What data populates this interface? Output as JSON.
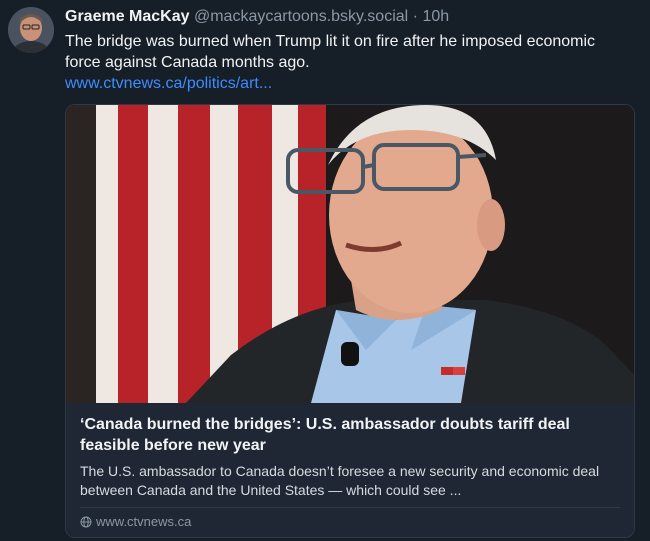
{
  "post": {
    "author": "Graeme MacKay",
    "handle": "@mackaycartoons.bsky.social",
    "separator": "·",
    "time": "10h",
    "text": "The bridge was burned when Trump lit it on fire after he imposed economic force against Canada months ago.",
    "link_text": "www.ctvnews.ca/politics/art..."
  },
  "card": {
    "title": "‘Canada burned the bridges’: U.S. ambassador doubts tariff deal feasible before new year",
    "description": "The U.S. ambassador to Canada doesn’t foresee a new security and economic deal between Canada and the United States — which could see ...",
    "domain": "www.ctvnews.ca",
    "domain_icon": "globe-icon"
  },
  "colors": {
    "background": "#161e27",
    "link": "#3e8cff",
    "muted": "#8b98a5"
  }
}
